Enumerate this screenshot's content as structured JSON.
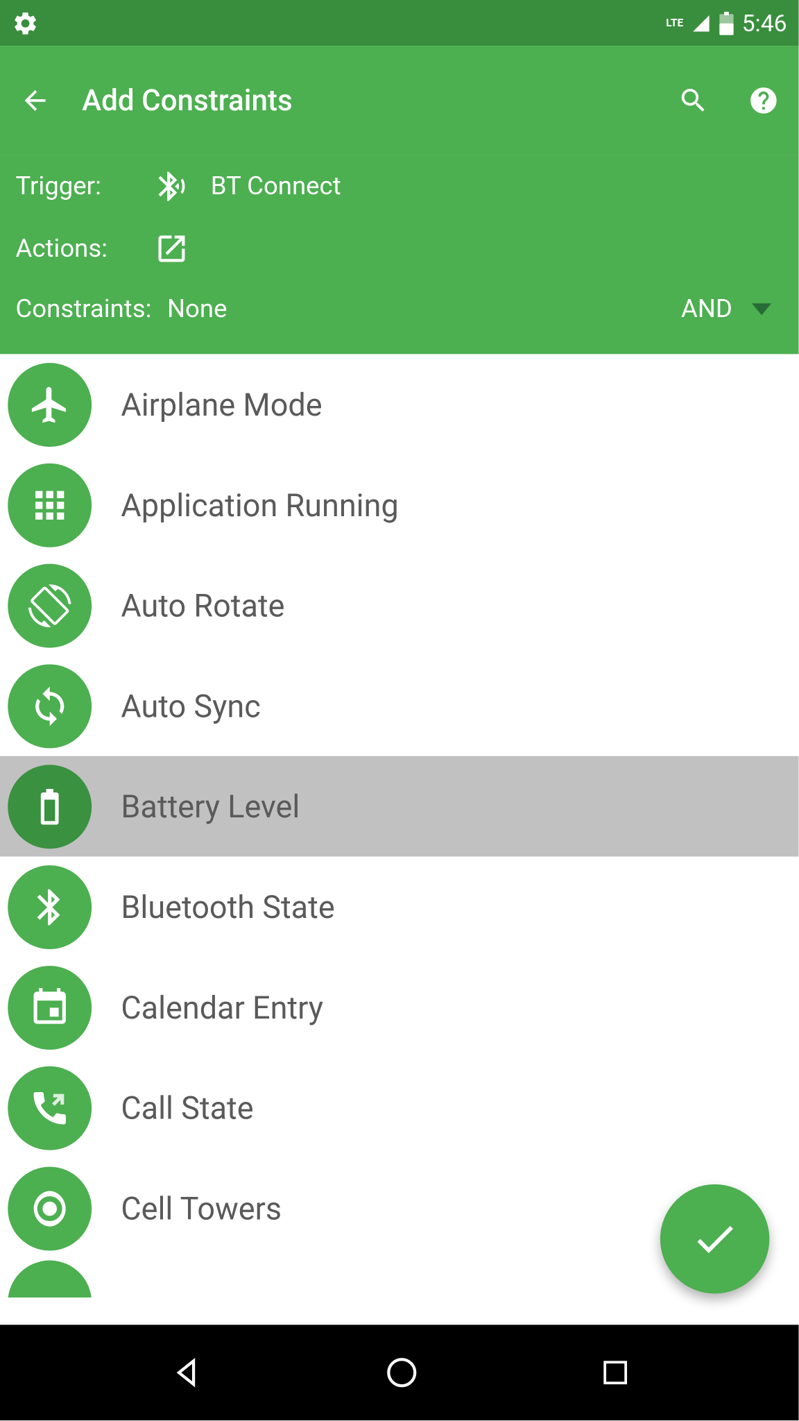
{
  "status_bar": {
    "time": "5:46",
    "network": "LTE",
    "battery": "51"
  },
  "app_bar": {
    "title": "Add Constraints"
  },
  "info": {
    "trigger_label": "Trigger:",
    "trigger_value": "BT Connect",
    "actions_label": "Actions:",
    "constraints_label": "Constraints:",
    "constraints_value": "None",
    "logic_operator": "AND"
  },
  "constraints": [
    {
      "label": "Airplane Mode",
      "icon": "airplane",
      "selected": false
    },
    {
      "label": "Application Running",
      "icon": "apps",
      "selected": false
    },
    {
      "label": "Auto Rotate",
      "icon": "rotate",
      "selected": false
    },
    {
      "label": "Auto Sync",
      "icon": "sync",
      "selected": false
    },
    {
      "label": "Battery Level",
      "icon": "battery",
      "selected": true
    },
    {
      "label": "Bluetooth State",
      "icon": "bluetooth",
      "selected": false
    },
    {
      "label": "Calendar Entry",
      "icon": "calendar",
      "selected": false
    },
    {
      "label": "Call State",
      "icon": "call",
      "selected": false
    },
    {
      "label": "Cell Towers",
      "icon": "tower",
      "selected": false
    }
  ]
}
